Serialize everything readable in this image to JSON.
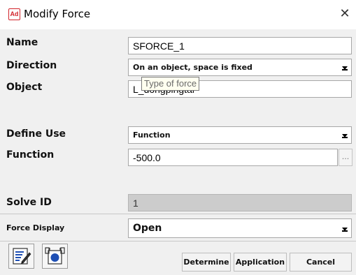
{
  "window": {
    "icon_text": "Ad",
    "title": "Modify Force",
    "close_glyph": "✕"
  },
  "form": {
    "name_label": "Name",
    "name_value": "SFORCE_1",
    "direction_label": "Direction",
    "direction_value": "On an object, space is fixed",
    "object_label": "Object",
    "object_value": "L_dongpingtai",
    "object_tooltip": "Type of force",
    "define_use_label": "Define Use",
    "define_use_value": "Function",
    "function_label": "Function",
    "function_value": "-500.0",
    "function_more": "...",
    "solve_id_label": "Solve ID",
    "solve_id_value": "1",
    "force_display_label": "Force Display",
    "force_display_value": "Open"
  },
  "buttons": {
    "determine": "Determine",
    "application": "Application",
    "cancel": "Cancel"
  },
  "icons": {
    "tool_1": "edit-list-icon",
    "tool_2": "property-icon"
  },
  "colors": {
    "app_icon_red": "#d2232a",
    "tool_icon_blue": "#1e4fb4"
  }
}
